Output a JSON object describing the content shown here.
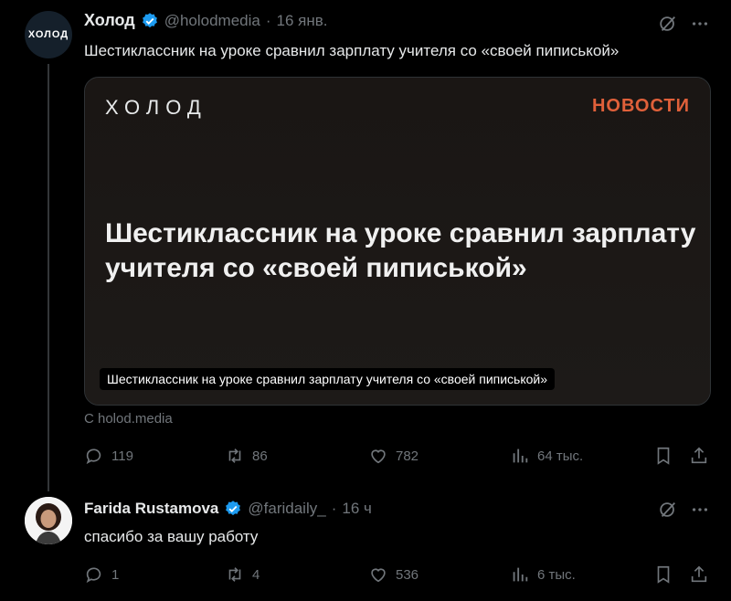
{
  "tweet1": {
    "avatar_text": "ХОЛОД",
    "name": "Холод",
    "handle": "@holodmedia",
    "sep": "·",
    "time": "16 янв.",
    "text": "Шестиклассник на уроке сравнил зарплату учителя со «своей пиписькой»",
    "card": {
      "brand": "ХОЛОД",
      "label": "НОВОСТИ",
      "headline": "Шестиклассник на уроке сравнил зарплату учителя со «своей пиписькой»",
      "caption": "Шестиклассник на уроке сравнил зарплату учителя со «своей пиписькой»"
    },
    "source": "С holod.media",
    "actions": {
      "replies": "119",
      "retweets": "86",
      "likes": "782",
      "views": "64 тыс."
    }
  },
  "tweet2": {
    "name": "Farida Rustamova",
    "handle": "@faridaily_",
    "sep": "·",
    "time": "16 ч",
    "text": "спасибо за вашу работу",
    "actions": {
      "replies": "1",
      "retweets": "4",
      "likes": "536",
      "views": "6 тыс."
    }
  },
  "colors": {
    "accent": "#1d9bf0",
    "news": "#e0603a",
    "muted": "#71767b"
  }
}
